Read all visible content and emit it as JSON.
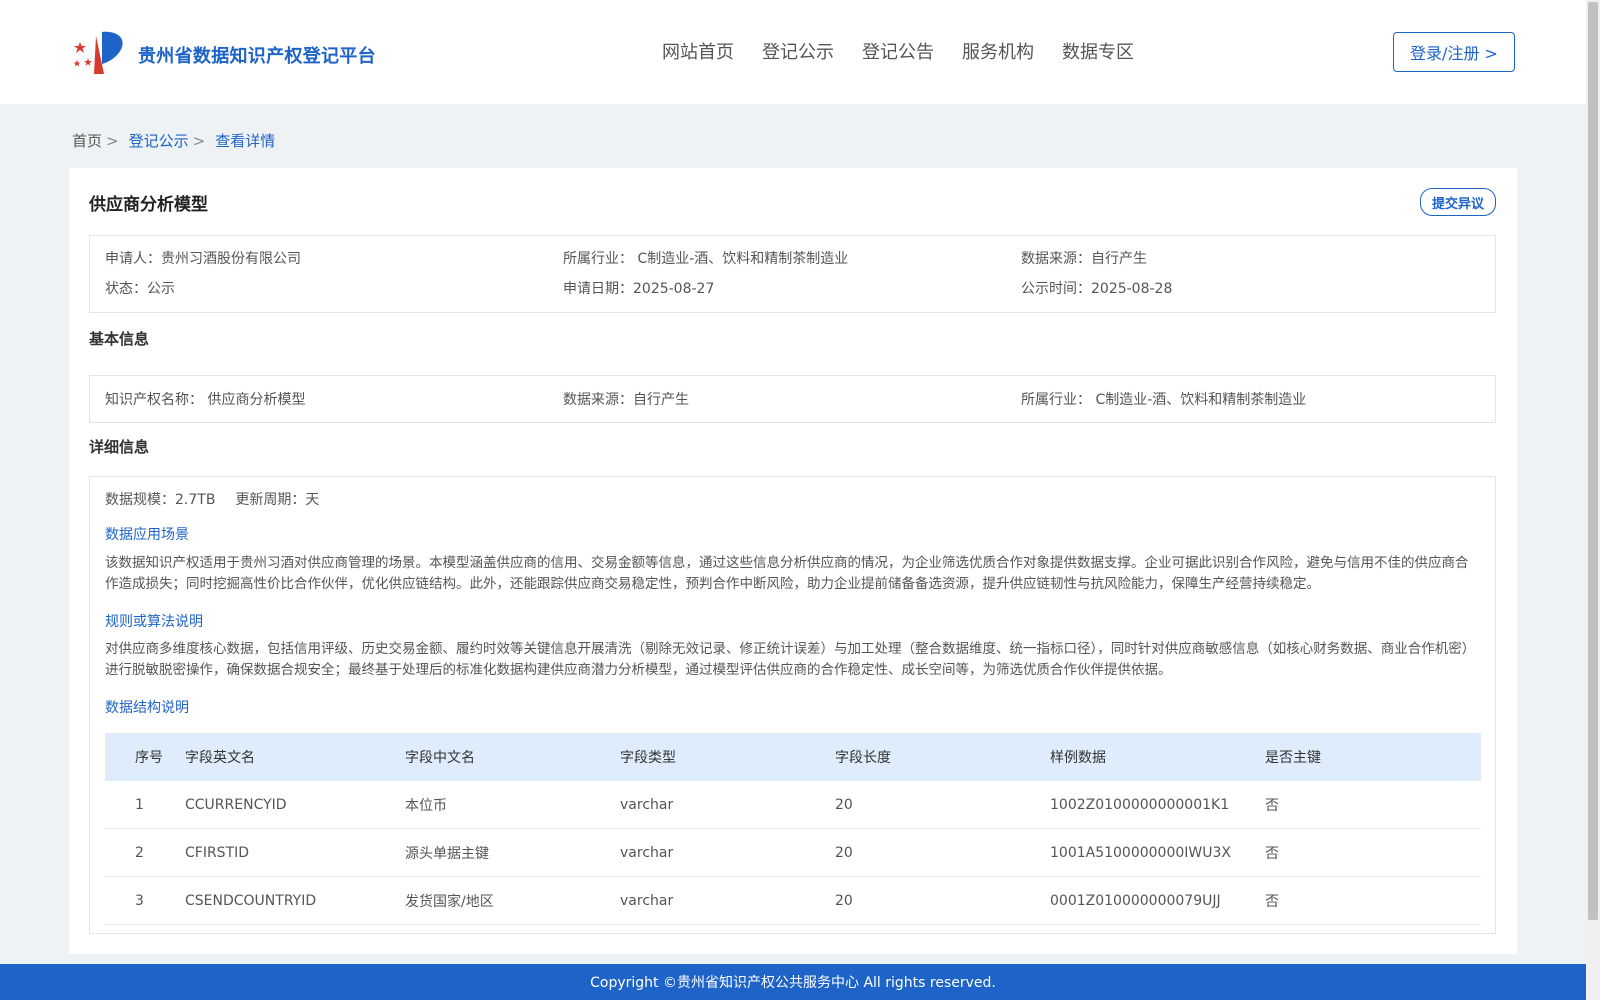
{
  "header": {
    "site_title": "贵州省数据知识产权登记平台",
    "nav": [
      "网站首页",
      "登记公示",
      "登记公告",
      "服务机构",
      "数据专区"
    ],
    "login_label": "登录/注册 >"
  },
  "breadcrumb": {
    "home": "首页",
    "home_sep": ">",
    "publicity": "登记公示",
    "publicity_sep": ">",
    "current": "查看详情"
  },
  "detail": {
    "title": "供应商分析模型",
    "objection_label": "提交异议",
    "meta": {
      "applicant": "申请人：贵州习酒股份有限公司",
      "industry": "所属行业： C制造业-酒、饮料和精制茶制造业",
      "source": "数据来源：自行产生",
      "status": "状态：公示",
      "apply_date": "申请日期：2025-08-27",
      "publicity_date": "公示时间：2025-08-28"
    },
    "basic": {
      "section_title": "基本信息",
      "ip_name": "知识产权名称： 供应商分析模型",
      "source": "数据来源：自行产生",
      "industry": "所属行业： C制造业-酒、饮料和精制茶制造业"
    },
    "details": {
      "section_title": "详细信息",
      "scale": "数据规模：2.7TB",
      "cycle": "更新周期：天",
      "scenario_title": "数据应用场景",
      "scenario_text": "该数据知识产权适用于贵州习酒对供应商管理的场景。本模型涵盖供应商的信用、交易金额等信息，通过这些信息分析供应商的情况，为企业筛选优质合作对象提供数据支撑。企业可据此识别合作风险，避免与信用不佳的供应商合作造成损失；同时挖掘高性价比合作伙伴，优化供应链结构。此外，还能跟踪供应商交易稳定性，预判合作中断风险，助力企业提前储备备选资源，提升供应链韧性与抗风险能力，保障生产经营持续稳定。",
      "rules_title": "规则或算法说明",
      "rules_text": "对供应商多维度核心数据，包括信用评级、历史交易金额、履约时效等关键信息开展清洗（剔除无效记录、修正统计误差）与加工处理（整合数据维度、统一指标口径），同时针对供应商敏感信息（如核心财务数据、商业合作机密）进行脱敏脱密操作，确保数据合规安全；最终基于处理后的标准化数据构建供应商潜力分析模型，通过模型评估供应商的合作稳定性、成长空间等，为筛选优质合作伙伴提供依据。",
      "structure_title": "数据结构说明",
      "table": {
        "headers": [
          "序号",
          "字段英文名",
          "字段中文名",
          "字段类型",
          "字段长度",
          "样例数据",
          "是否主键"
        ],
        "rows": [
          [
            "1",
            "CCURRENCYID",
            "本位币",
            "varchar",
            "20",
            "1002Z0100000000001K1",
            "否"
          ],
          [
            "2",
            "CFIRSTID",
            "源头单据主键",
            "varchar",
            "20",
            "1001A5100000000IWU3X",
            "否"
          ],
          [
            "3",
            "CSENDCOUNTRYID",
            "发货国家/地区",
            "varchar",
            "20",
            "0001Z010000000079UJJ",
            "否"
          ]
        ]
      }
    }
  },
  "footer": {
    "copyright": "Copyright ©贵州省知识产权公共服务中心 All rights reserved."
  },
  "colors": {
    "brand_blue": "#1e63c8",
    "logo_red": "#d83b2e",
    "table_header_bg": "#deecfc",
    "page_bg": "#eff2f5"
  },
  "icons": {
    "logo": "platform-logo-icon"
  }
}
